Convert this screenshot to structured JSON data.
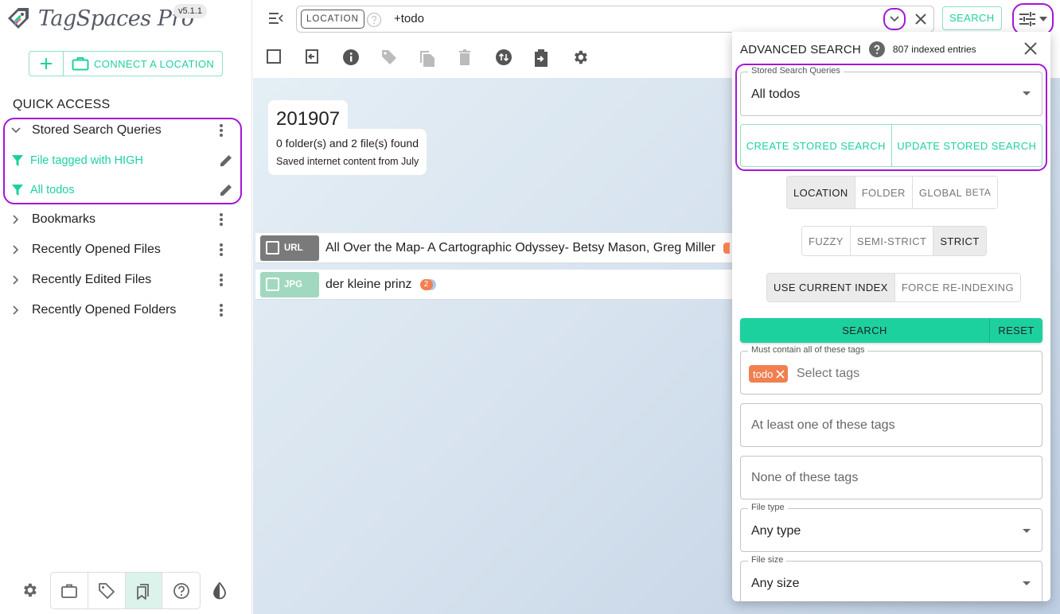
{
  "app": {
    "name": "TagSpaces Pro",
    "version": "v5.1.1"
  },
  "sidebar": {
    "connect_location_label": "CONNECT A LOCATION",
    "quick_access_title": "QUICK ACCESS",
    "sections": [
      {
        "label": "Stored Search Queries",
        "expanded": true
      },
      {
        "label": "Bookmarks",
        "expanded": false
      },
      {
        "label": "Recently Opened Files",
        "expanded": false
      },
      {
        "label": "Recently Edited Files",
        "expanded": false
      },
      {
        "label": "Recently Opened Folders",
        "expanded": false
      }
    ],
    "stored_queries": [
      {
        "label": "File tagged with HIGH"
      },
      {
        "label": "All todos"
      }
    ],
    "bottom_nav": [
      {
        "icon": "settings-icon"
      },
      {
        "icon": "locations-icon"
      },
      {
        "icon": "tag-library-icon"
      },
      {
        "icon": "quick-access-icon",
        "active": true
      },
      {
        "icon": "help-icon"
      },
      {
        "icon": "theme-contrast-icon"
      }
    ]
  },
  "search_bar": {
    "scope_chip": "LOCATION",
    "query": "+todo",
    "search_button": "SEARCH"
  },
  "toolbar": {
    "icons": [
      "select-all-icon",
      "go-back-icon",
      "info-icon",
      "tag-icon",
      "copy-icon",
      "delete-icon",
      "sort-icon",
      "export-icon",
      "settings-icon"
    ]
  },
  "folder": {
    "name": "201907",
    "summary": "0 folder(s) and 2 file(s) found",
    "description": "Saved internet content from July"
  },
  "files": [
    {
      "type": "URL",
      "name": "All Over the Map- A Cartographic Odyssey- Betsy Mason, Greg Miller",
      "type_color": "#7a7a7a",
      "tag_count": ""
    },
    {
      "type": "JPG",
      "name": "der kleine prinz",
      "type_color": "#a1d8bf",
      "tag_count": "2"
    }
  ],
  "advanced_search": {
    "title": "ADVANCED SEARCH",
    "indexed_entries": "807 indexed entries",
    "stored_queries_label": "Stored Search Queries",
    "stored_queries_value": "All todos",
    "create_stored": "CREATE STORED SEARCH",
    "update_stored": "UPDATE STORED SEARCH",
    "scope_options": [
      {
        "label": "LOCATION",
        "active": true
      },
      {
        "label": "FOLDER",
        "active": false
      },
      {
        "label": "GLOBAL",
        "badge": "BETA",
        "active": false
      }
    ],
    "match_options": [
      {
        "label": "FUZZY",
        "active": false
      },
      {
        "label": "SEMI-STRICT",
        "active": false
      },
      {
        "label": "STRICT",
        "active": true
      }
    ],
    "index_options": [
      {
        "label": "USE CURRENT INDEX",
        "active": true
      },
      {
        "label": "FORCE RE-INDEXING",
        "active": false
      }
    ],
    "search_button": "SEARCH",
    "reset_button": "RESET",
    "must_contain_label": "Must contain all of these tags",
    "must_contain_tags": [
      {
        "label": "todo",
        "color": "#f08050"
      }
    ],
    "select_tags_placeholder": "Select tags",
    "at_least_one_placeholder": "At least one of these tags",
    "none_of_placeholder": "None of these tags",
    "file_type_label": "File type",
    "file_type_value": "Any type",
    "file_size_label": "File size",
    "file_size_value": "Any size"
  },
  "colors": {
    "accent": "#1dd19f",
    "highlight": "#a415d9",
    "tag_orange": "#f08050"
  }
}
